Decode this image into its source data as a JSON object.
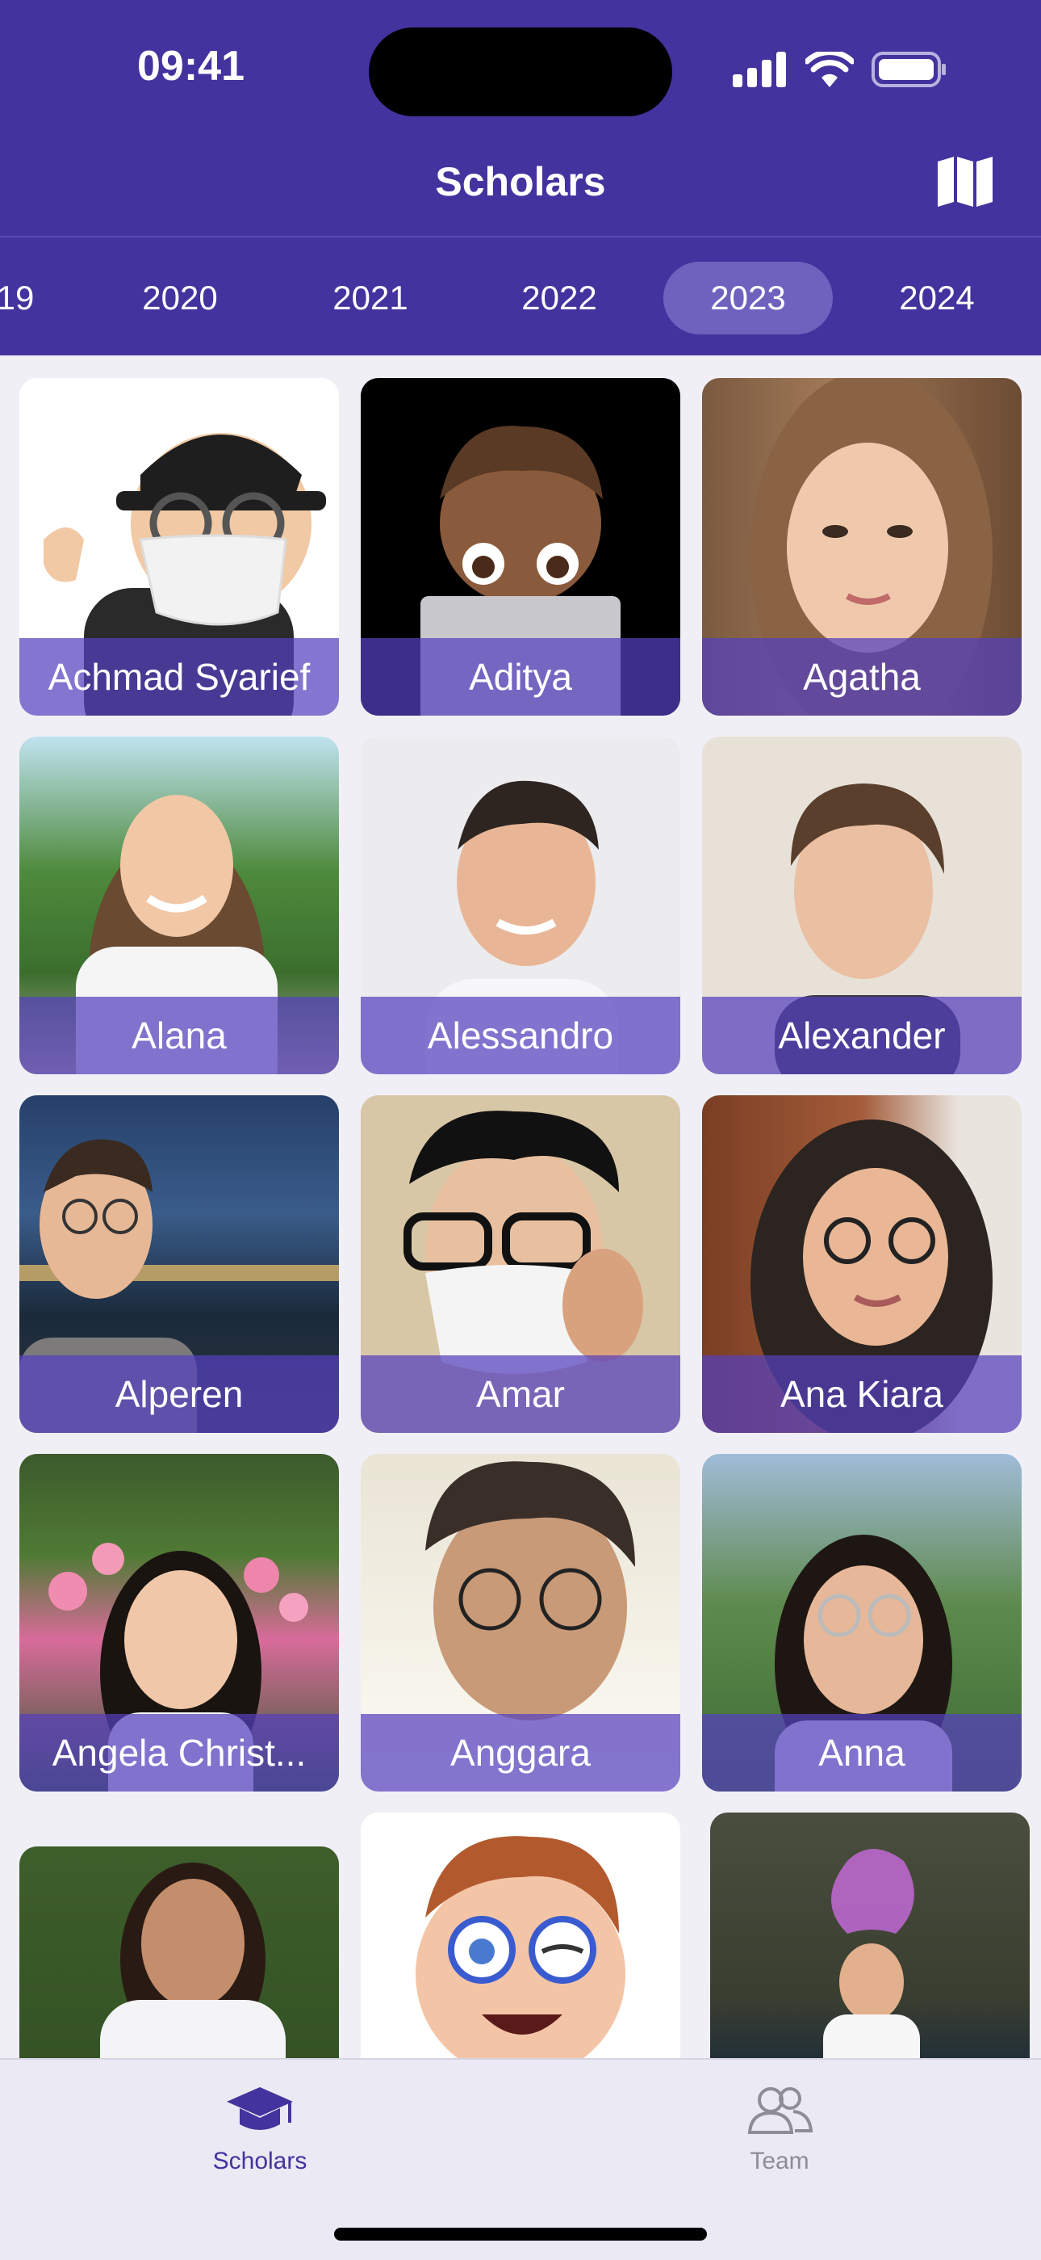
{
  "status": {
    "time": "09:41"
  },
  "nav": {
    "title": "Scholars",
    "map_icon": "map-icon"
  },
  "years": [
    "19",
    "2020",
    "2021",
    "2022",
    "2023",
    "2024"
  ],
  "selected_year": "2023",
  "scholars": [
    "Achmad Syarief",
    "Aditya",
    "Agatha",
    "Alana",
    "Alessandro",
    "Alexander",
    "Alperen",
    "Amar",
    "Ana Kiara",
    "Angela Christ...",
    "Anggara",
    "Anna"
  ],
  "tabs": [
    {
      "label": "Scholars",
      "icon": "graduation-cap-icon",
      "active": true
    },
    {
      "label": "Team",
      "icon": "people-icon",
      "active": false
    }
  ],
  "colors": {
    "brand": "#43339e",
    "active_tab": "#43339e",
    "inactive_tab": "#8e8c97"
  }
}
